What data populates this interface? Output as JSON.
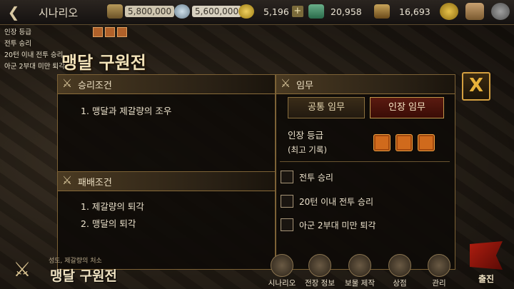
{
  "topbar": {
    "title": "시나리오",
    "resources": [
      {
        "name": "gold-bars",
        "value": "5,800,000"
      },
      {
        "name": "silver",
        "value": "5,600,000"
      },
      {
        "name": "coin",
        "value": "5,196"
      },
      {
        "name": "jade",
        "value": "20,958"
      },
      {
        "name": "horse",
        "value": "16,693"
      }
    ]
  },
  "quest_info": {
    "grade_label": "인장 등급",
    "lines": [
      "전투 승리",
      "20턴 이내 전투 승리",
      "아군 2부대 미만 퇴각"
    ]
  },
  "stage_title": "맹달 구원전",
  "victory": {
    "header": "승리조건",
    "items": [
      "1. 맹달과 제갈량의 조우"
    ]
  },
  "defeat": {
    "header": "패배조건",
    "items": [
      "1. 제갈량의 퇴각",
      "2. 맹달의 퇴각"
    ]
  },
  "mission": {
    "header": "임무",
    "tabs": [
      {
        "label": "공통 임무",
        "active": false
      },
      {
        "label": "인장 임무",
        "active": true
      }
    ],
    "grade_label": "인장 등급",
    "grade_sub": "(최고 기록)",
    "objectives": [
      "전투 승리",
      "20턴 이내 전투 승리",
      "아군 2부대 미만 퇴각"
    ]
  },
  "close_label": "X",
  "bottom": {
    "subtitle": "성도, 제갈량의 처소",
    "title": "맹달 구원전",
    "nav": [
      "시나리오",
      "전장 정보",
      "보물 제작",
      "상점",
      "관리"
    ],
    "depart": "출진"
  },
  "colors": {
    "accent": "#d4a040",
    "active_tab": "#5a1a10",
    "seal": "#d06a1c"
  }
}
